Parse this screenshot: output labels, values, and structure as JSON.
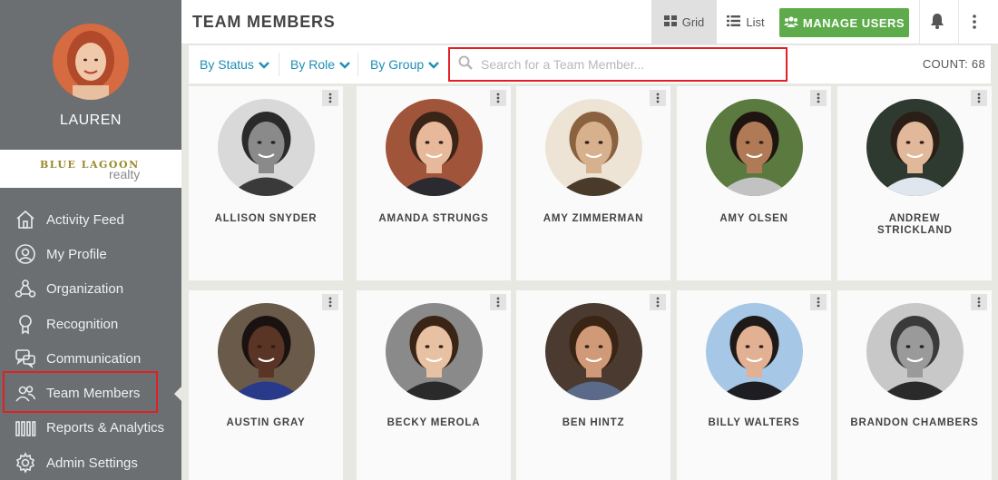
{
  "user": {
    "name": "LAUREN"
  },
  "brand": {
    "line1": "BLUE LAGOON",
    "line2": "realty"
  },
  "nav": [
    {
      "label": "Activity Feed",
      "icon": "home-icon"
    },
    {
      "label": "My Profile",
      "icon": "user-circle-icon"
    },
    {
      "label": "Organization",
      "icon": "organization-icon"
    },
    {
      "label": "Recognition",
      "icon": "award-ribbon-icon"
    },
    {
      "label": "Communication",
      "icon": "chat-bubbles-icon"
    },
    {
      "label": "Team Members",
      "icon": "team-icon"
    },
    {
      "label": "Reports & Analytics",
      "icon": "bar-chart-icon"
    },
    {
      "label": "Admin Settings",
      "icon": "gear-icon"
    }
  ],
  "header": {
    "title": "TEAM MEMBERS",
    "grid_label": "Grid",
    "list_label": "List",
    "manage_label": "MANAGE USERS"
  },
  "filters": {
    "status": "By Status",
    "role": "By Role",
    "group": "By Group",
    "search_placeholder": "Search for a Team Member...",
    "count": "COUNT: 68"
  },
  "members": [
    {
      "name": "ALLISON SNYDER",
      "bg": "#d9d9d9",
      "skin": "#8a8a8a",
      "hair": "#2a2a2a",
      "shirt": "#3a3a3a"
    },
    {
      "name": "AMANDA STRUNGS",
      "bg": "#a0543a",
      "skin": "#e8b89a",
      "hair": "#3a2418",
      "shirt": "#2a2a30"
    },
    {
      "name": "AMY ZIMMERMAN",
      "bg": "#ede4d6",
      "skin": "#d7b08e",
      "hair": "#8a6240",
      "shirt": "#4a3a2a"
    },
    {
      "name": "AMY OLSEN",
      "bg": "#5a7a40",
      "skin": "#b07a56",
      "hair": "#1e1410",
      "shirt": "#c2c2c2"
    },
    {
      "name": "ANDREW STRICKLAND",
      "bg": "#2e3a30",
      "skin": "#e2b89a",
      "hair": "#2a1e16",
      "shirt": "#dfe6ee"
    },
    {
      "name": "AUSTIN GRAY",
      "bg": "#6a5a4a",
      "skin": "#5a3424",
      "hair": "#1a1210",
      "shirt": "#2a3a8a"
    },
    {
      "name": "BECKY MEROLA",
      "bg": "#8a8a8a",
      "skin": "#e8c0a2",
      "hair": "#3a2416",
      "shirt": "#2a2a2a"
    },
    {
      "name": "BEN HINTZ",
      "bg": "#4a3a30",
      "skin": "#d09a78",
      "hair": "#3a2414",
      "shirt": "#5a6a88"
    },
    {
      "name": "BILLY WALTERS",
      "bg": "#a6c8e6",
      "skin": "#e2b092",
      "hair": "#1e1a18",
      "shirt": "#1e1e22"
    },
    {
      "name": "BRANDON CHAMBERS",
      "bg": "#c8c8c8",
      "skin": "#9a9a9a",
      "hair": "#3a3a3a",
      "shirt": "#2a2a2a"
    }
  ]
}
